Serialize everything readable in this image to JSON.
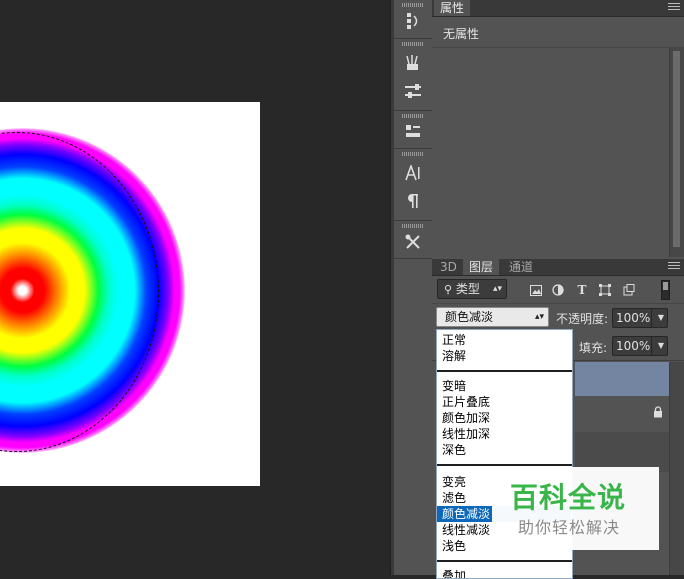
{
  "properties_panel": {
    "tab": "属性",
    "content": "无属性"
  },
  "layers_panel": {
    "tabs": [
      {
        "label": "3D"
      },
      {
        "label": "图层"
      },
      {
        "label": "通道"
      }
    ],
    "filter_kind": "类型",
    "blend_mode": "颜色减淡",
    "opacity_label": "不透明度:",
    "opacity_value": "100%",
    "fill_label": "填充:",
    "fill_value": "100%"
  },
  "blend_menu": {
    "groups": [
      [
        "正常",
        "溶解"
      ],
      [
        "变暗",
        "正片叠底",
        "颜色加深",
        "线性加深",
        "深色"
      ],
      [
        "变亮",
        "滤色",
        "颜色减淡",
        "线性减淡",
        "浅色"
      ],
      [
        "叠加"
      ]
    ],
    "selected": "颜色减淡"
  },
  "tools": [
    "history-icon",
    "brush-presets-icon",
    "adjustments-icon",
    "clone-source-icon",
    "character-icon",
    "paragraph-icon",
    "tool-presets-icon"
  ],
  "watermark": {
    "title": "百科全说",
    "subtitle": "助你轻松解决"
  },
  "colors": {
    "panel_bg": "#535353",
    "canvas_bg": "#282828",
    "selection_highlight": "#0d68b9",
    "selected_layer": "#7385a1",
    "watermark_green": "#39b54a"
  }
}
